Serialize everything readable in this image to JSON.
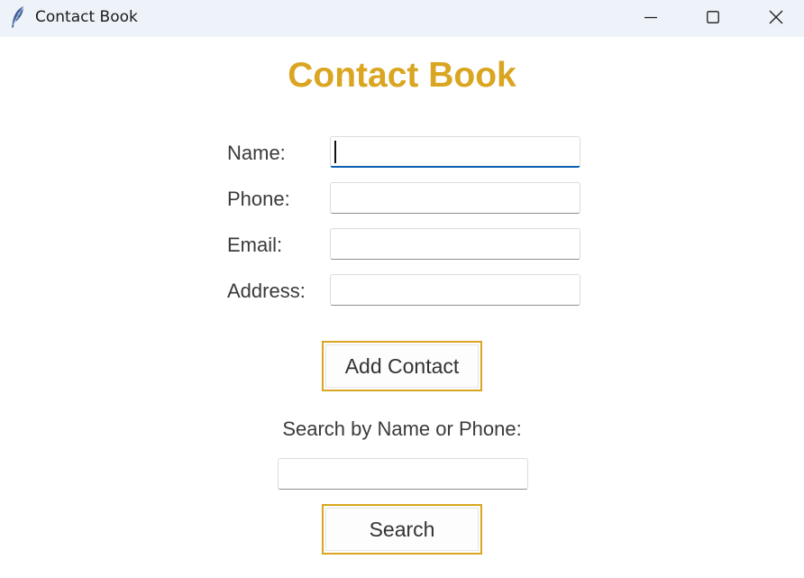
{
  "window": {
    "title": "Contact Book",
    "icon": "feather-icon",
    "controls": [
      "minimize-icon",
      "maximize-icon",
      "close-icon"
    ]
  },
  "heading": "Contact Book",
  "form": {
    "name_label": "Name:",
    "name_value": "",
    "phone_label": "Phone:",
    "phone_value": "",
    "email_label": "Email:",
    "email_value": "",
    "address_label": "Address:",
    "address_value": ""
  },
  "add_button_label": "Add Contact",
  "search": {
    "label": "Search by Name or Phone:",
    "value": "",
    "button_label": "Search"
  },
  "colors": {
    "accent": "#daa520",
    "focus": "#0a5fb4",
    "titlebar": "#eef3f9"
  }
}
